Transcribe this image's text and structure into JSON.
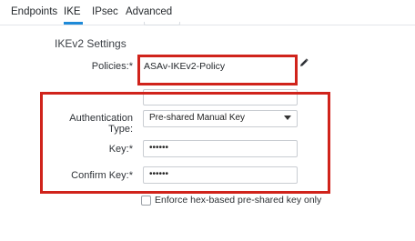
{
  "tabs": [
    {
      "label": "Endpoints"
    },
    {
      "label": "IKE"
    },
    {
      "label": "IPsec"
    },
    {
      "label": "Advanced"
    }
  ],
  "section": {
    "title": "IKEv2 Settings"
  },
  "policies": {
    "label": "Policies:*",
    "value": "ASAv-IKEv2-Policy"
  },
  "auth": {
    "label": "Authentication Type:",
    "value": "Pre-shared Manual Key"
  },
  "key": {
    "label": "Key:*",
    "value": "••••••"
  },
  "confirm_key": {
    "label": "Confirm Key:*",
    "value": "••••••"
  },
  "hex_option": {
    "label": "Enforce hex-based pre-shared key only"
  },
  "colors": {
    "highlight": "#d0231b",
    "tab_accent": "#1e8ad8"
  }
}
